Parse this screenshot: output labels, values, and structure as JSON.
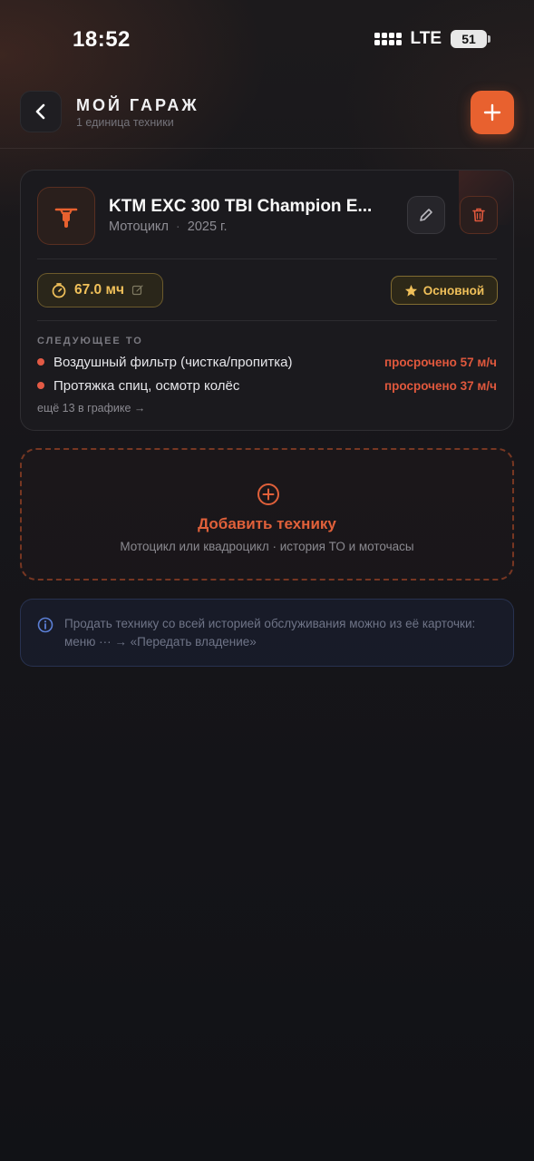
{
  "status_bar": {
    "time": "18:52",
    "network": "LTE",
    "battery": "51"
  },
  "header": {
    "title": "МОЙ ГАРАЖ",
    "subtitle": "1 единица техники",
    "back_icon": "chevron-left-icon",
    "add_icon": "plus-icon"
  },
  "vehicle": {
    "name": "KTM EXC 300 TBI Champion E...",
    "type": "Мотоцикл",
    "separator": "·",
    "year": "2025 г.",
    "icon": "motorcycle-icon",
    "hours_value": "67.0 мч",
    "primary_badge": "Основной",
    "next_service_label": "СЛЕДУЮЩЕЕ ТО",
    "maintenance": [
      {
        "name": "Воздушный фильтр (чистка/пропитка)",
        "due": "просрочено 57 м/ч"
      },
      {
        "name": "Протяжка спиц, осмотр колёс",
        "due": "просрочено 37 м/ч"
      }
    ],
    "more_link": "ещё 13 в графике →"
  },
  "add_vehicle": {
    "title": "Добавить технику",
    "subtitle": "Мотоцикл или квадроцикл · история ТО и моточасы"
  },
  "info": {
    "text": "Продать технику со всей историей обслуживания можно из её карточки: меню ··· → «Передать владение»"
  },
  "colors": {
    "accent": "#e8612f",
    "gold": "#f0c05a",
    "overdue": "#e0583d",
    "background": "#17161a"
  }
}
